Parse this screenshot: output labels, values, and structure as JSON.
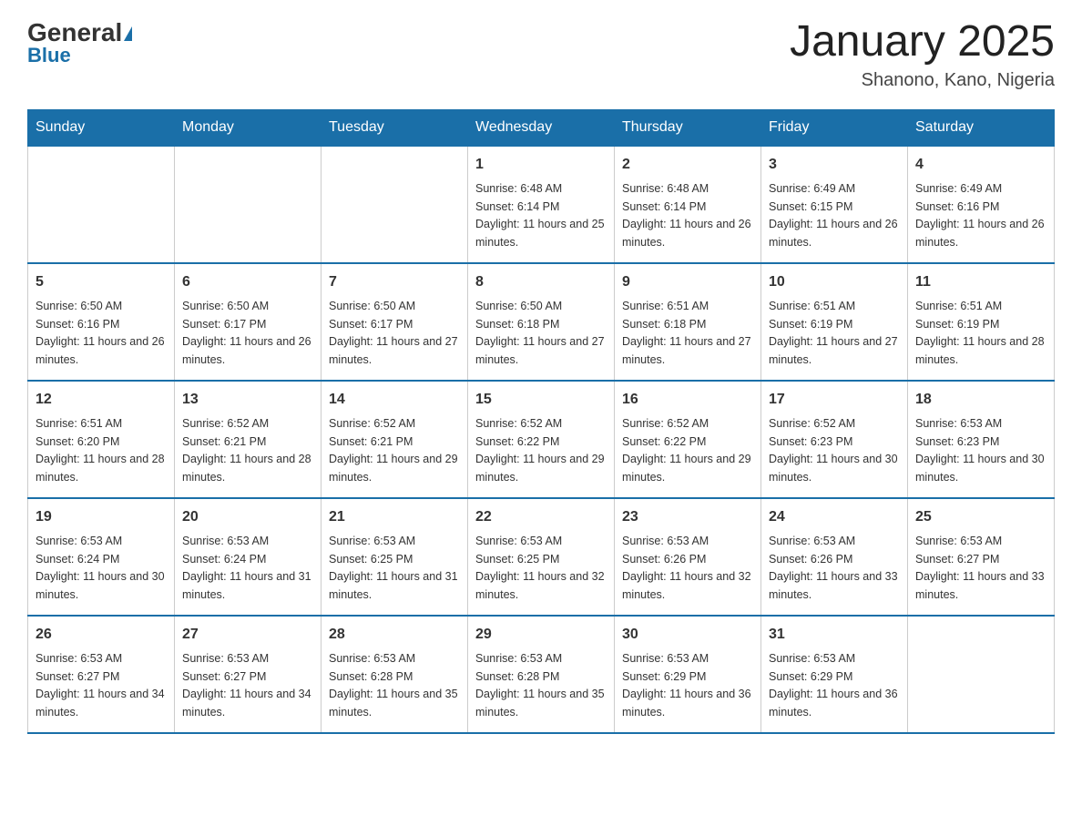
{
  "header": {
    "logo": {
      "general": "General",
      "blue": "Blue"
    },
    "title": "January 2025",
    "location": "Shanono, Kano, Nigeria"
  },
  "weekdays": [
    "Sunday",
    "Monday",
    "Tuesday",
    "Wednesday",
    "Thursday",
    "Friday",
    "Saturday"
  ],
  "weeks": [
    [
      {
        "day": "",
        "info": ""
      },
      {
        "day": "",
        "info": ""
      },
      {
        "day": "",
        "info": ""
      },
      {
        "day": "1",
        "info": "Sunrise: 6:48 AM\nSunset: 6:14 PM\nDaylight: 11 hours and 25 minutes."
      },
      {
        "day": "2",
        "info": "Sunrise: 6:48 AM\nSunset: 6:14 PM\nDaylight: 11 hours and 26 minutes."
      },
      {
        "day": "3",
        "info": "Sunrise: 6:49 AM\nSunset: 6:15 PM\nDaylight: 11 hours and 26 minutes."
      },
      {
        "day": "4",
        "info": "Sunrise: 6:49 AM\nSunset: 6:16 PM\nDaylight: 11 hours and 26 minutes."
      }
    ],
    [
      {
        "day": "5",
        "info": "Sunrise: 6:50 AM\nSunset: 6:16 PM\nDaylight: 11 hours and 26 minutes."
      },
      {
        "day": "6",
        "info": "Sunrise: 6:50 AM\nSunset: 6:17 PM\nDaylight: 11 hours and 26 minutes."
      },
      {
        "day": "7",
        "info": "Sunrise: 6:50 AM\nSunset: 6:17 PM\nDaylight: 11 hours and 27 minutes."
      },
      {
        "day": "8",
        "info": "Sunrise: 6:50 AM\nSunset: 6:18 PM\nDaylight: 11 hours and 27 minutes."
      },
      {
        "day": "9",
        "info": "Sunrise: 6:51 AM\nSunset: 6:18 PM\nDaylight: 11 hours and 27 minutes."
      },
      {
        "day": "10",
        "info": "Sunrise: 6:51 AM\nSunset: 6:19 PM\nDaylight: 11 hours and 27 minutes."
      },
      {
        "day": "11",
        "info": "Sunrise: 6:51 AM\nSunset: 6:19 PM\nDaylight: 11 hours and 28 minutes."
      }
    ],
    [
      {
        "day": "12",
        "info": "Sunrise: 6:51 AM\nSunset: 6:20 PM\nDaylight: 11 hours and 28 minutes."
      },
      {
        "day": "13",
        "info": "Sunrise: 6:52 AM\nSunset: 6:21 PM\nDaylight: 11 hours and 28 minutes."
      },
      {
        "day": "14",
        "info": "Sunrise: 6:52 AM\nSunset: 6:21 PM\nDaylight: 11 hours and 29 minutes."
      },
      {
        "day": "15",
        "info": "Sunrise: 6:52 AM\nSunset: 6:22 PM\nDaylight: 11 hours and 29 minutes."
      },
      {
        "day": "16",
        "info": "Sunrise: 6:52 AM\nSunset: 6:22 PM\nDaylight: 11 hours and 29 minutes."
      },
      {
        "day": "17",
        "info": "Sunrise: 6:52 AM\nSunset: 6:23 PM\nDaylight: 11 hours and 30 minutes."
      },
      {
        "day": "18",
        "info": "Sunrise: 6:53 AM\nSunset: 6:23 PM\nDaylight: 11 hours and 30 minutes."
      }
    ],
    [
      {
        "day": "19",
        "info": "Sunrise: 6:53 AM\nSunset: 6:24 PM\nDaylight: 11 hours and 30 minutes."
      },
      {
        "day": "20",
        "info": "Sunrise: 6:53 AM\nSunset: 6:24 PM\nDaylight: 11 hours and 31 minutes."
      },
      {
        "day": "21",
        "info": "Sunrise: 6:53 AM\nSunset: 6:25 PM\nDaylight: 11 hours and 31 minutes."
      },
      {
        "day": "22",
        "info": "Sunrise: 6:53 AM\nSunset: 6:25 PM\nDaylight: 11 hours and 32 minutes."
      },
      {
        "day": "23",
        "info": "Sunrise: 6:53 AM\nSunset: 6:26 PM\nDaylight: 11 hours and 32 minutes."
      },
      {
        "day": "24",
        "info": "Sunrise: 6:53 AM\nSunset: 6:26 PM\nDaylight: 11 hours and 33 minutes."
      },
      {
        "day": "25",
        "info": "Sunrise: 6:53 AM\nSunset: 6:27 PM\nDaylight: 11 hours and 33 minutes."
      }
    ],
    [
      {
        "day": "26",
        "info": "Sunrise: 6:53 AM\nSunset: 6:27 PM\nDaylight: 11 hours and 34 minutes."
      },
      {
        "day": "27",
        "info": "Sunrise: 6:53 AM\nSunset: 6:27 PM\nDaylight: 11 hours and 34 minutes."
      },
      {
        "day": "28",
        "info": "Sunrise: 6:53 AM\nSunset: 6:28 PM\nDaylight: 11 hours and 35 minutes."
      },
      {
        "day": "29",
        "info": "Sunrise: 6:53 AM\nSunset: 6:28 PM\nDaylight: 11 hours and 35 minutes."
      },
      {
        "day": "30",
        "info": "Sunrise: 6:53 AM\nSunset: 6:29 PM\nDaylight: 11 hours and 36 minutes."
      },
      {
        "day": "31",
        "info": "Sunrise: 6:53 AM\nSunset: 6:29 PM\nDaylight: 11 hours and 36 minutes."
      },
      {
        "day": "",
        "info": ""
      }
    ]
  ]
}
